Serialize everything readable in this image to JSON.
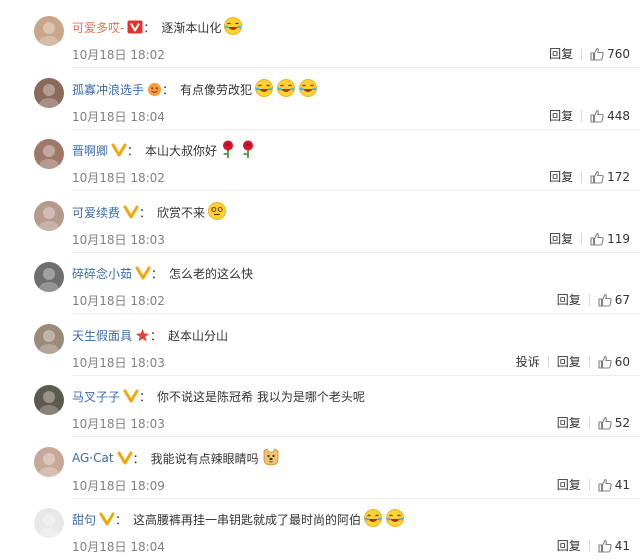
{
  "comments": [
    {
      "username": "可爱多哎-",
      "name_color": "orange",
      "badge": "vip",
      "text": "逐渐本山化",
      "emojis": [
        "laugh-cry"
      ],
      "time": "10月18日 18:02",
      "report": "",
      "reply": "回复",
      "likes": "760",
      "avatar_color": "#c9a58a"
    },
    {
      "username": "孤寡冲浪选手",
      "name_color": "blue",
      "badge": "face",
      "text": "有点像劳改犯",
      "emojis": [
        "laugh-cry",
        "laugh-cry",
        "laugh-cry"
      ],
      "time": "10月18日 18:04",
      "report": "",
      "reply": "回复",
      "likes": "448",
      "avatar_color": "#8a6a5a"
    },
    {
      "username": "晋啊卿",
      "name_color": "blue",
      "badge": "v-gold",
      "text": "本山大叔你好",
      "emojis": [
        "rose",
        "rose"
      ],
      "time": "10月18日 18:02",
      "report": "",
      "reply": "回复",
      "likes": "172",
      "avatar_color": "#a0786a"
    },
    {
      "username": "可爱续费",
      "name_color": "blue",
      "badge": "v-gold",
      "text": "欣赏不来",
      "emojis": [
        "dizzy"
      ],
      "time": "10月18日 18:03",
      "report": "",
      "reply": "回复",
      "likes": "119",
      "avatar_color": "#b69a8e"
    },
    {
      "username": "碎碎念小茹",
      "name_color": "blue",
      "badge": "v-gold",
      "text": "怎么老的这么快",
      "emojis": [],
      "time": "10月18日 18:02",
      "report": "",
      "reply": "回复",
      "likes": "67",
      "avatar_color": "#6f6f6f"
    },
    {
      "username": "天生假面具",
      "name_color": "blue",
      "badge": "star",
      "text": "赵本山分山",
      "emojis": [],
      "time": "10月18日 18:03",
      "report": "投诉",
      "reply": "回复",
      "likes": "60",
      "avatar_color": "#9a8a78"
    },
    {
      "username": "马叉子子",
      "name_color": "blue",
      "badge": "v-gold",
      "text": "你不说这是陈冠希 我以为是哪个老头呢",
      "emojis": [],
      "time": "10月18日 18:03",
      "report": "",
      "reply": "回复",
      "likes": "52",
      "avatar_color": "#5f5a4e"
    },
    {
      "username": "AG·Cat",
      "name_color": "blue",
      "badge": "v-gold",
      "text": "我能说有点辣眼睛吗",
      "emojis": [
        "doge"
      ],
      "time": "10月18日 18:09",
      "report": "",
      "reply": "回复",
      "likes": "41",
      "avatar_color": "#c8a898"
    },
    {
      "username": "甜句",
      "name_color": "blue",
      "badge": "v-gold",
      "text": "这高腰裤再挂一串钥匙就成了最时尚的阿伯",
      "emojis": [
        "laugh-cry",
        "laugh-cry"
      ],
      "time": "10月18日 18:04",
      "report": "",
      "reply": "回复",
      "likes": "41",
      "avatar_color": "#e8e8e8"
    }
  ]
}
